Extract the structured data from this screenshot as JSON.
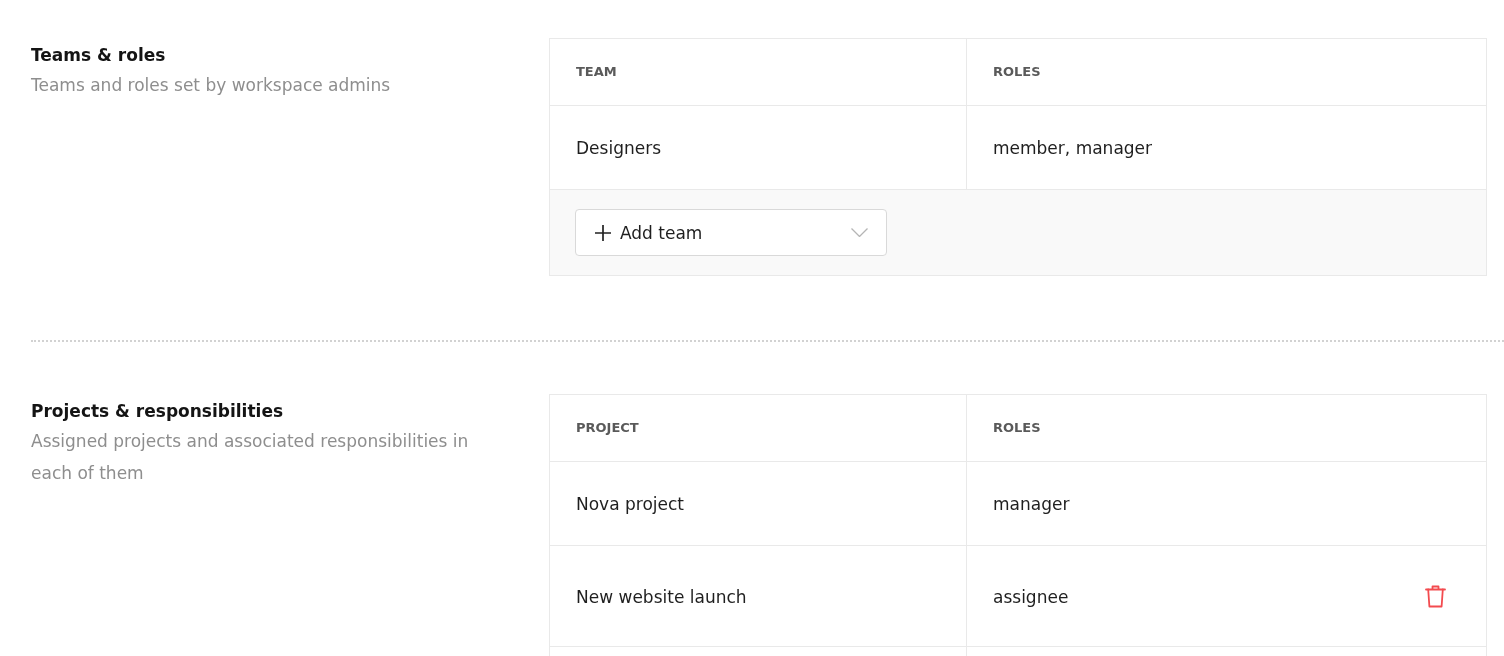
{
  "sections": [
    {
      "title": "Teams & roles",
      "description": "Teams and roles set by workspace admins",
      "table": {
        "columns": [
          "TEAM",
          "ROLES"
        ],
        "rows": [
          {
            "cells": [
              "Designers",
              "member, manager"
            ],
            "show_delete": false
          }
        ]
      },
      "add_button": {
        "label": "Add team"
      }
    },
    {
      "title": "Projects & responsibilities",
      "description": "Assigned projects and associated responsibilities in each of them",
      "table": {
        "columns": [
          "PROJECT",
          "ROLES"
        ],
        "rows": [
          {
            "cells": [
              "Nova project",
              "manager"
            ],
            "show_delete": false
          },
          {
            "cells": [
              "New website launch",
              "assignee"
            ],
            "show_delete": true
          }
        ]
      }
    }
  ]
}
